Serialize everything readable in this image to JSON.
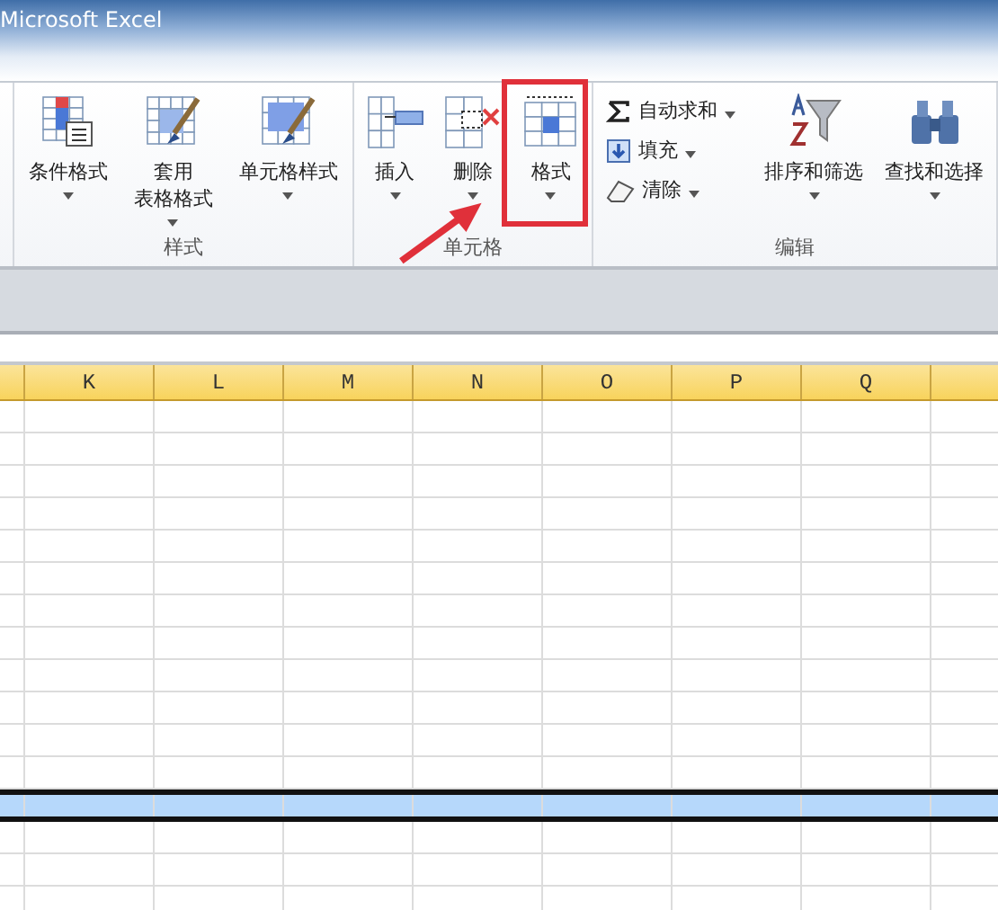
{
  "window": {
    "title": "Microsoft Excel"
  },
  "ribbon": {
    "groups": [
      {
        "label": "样式",
        "large": [
          {
            "lines": [
              "条件格式"
            ]
          },
          {
            "lines": [
              "套用",
              "表格格式"
            ]
          },
          {
            "lines": [
              "单元格样式"
            ]
          }
        ]
      },
      {
        "label": "单元格",
        "large": [
          {
            "lines": [
              "插入"
            ]
          },
          {
            "lines": [
              "删除"
            ]
          },
          {
            "lines": [
              "格式"
            ]
          }
        ]
      },
      {
        "label": "编辑",
        "small": [
          {
            "label": "自动求和"
          },
          {
            "label": "填充"
          },
          {
            "label": "清除"
          }
        ],
        "large": [
          {
            "lines": [
              "排序和筛选"
            ]
          },
          {
            "lines": [
              "查找和选择"
            ]
          }
        ]
      }
    ]
  },
  "sheet": {
    "columns": [
      "K",
      "L",
      "M",
      "N",
      "O",
      "P",
      "Q"
    ],
    "rows": [
      {
        "selected": false
      },
      {
        "selected": false
      },
      {
        "selected": false
      },
      {
        "selected": false
      },
      {
        "selected": false
      },
      {
        "selected": false
      },
      {
        "selected": false
      },
      {
        "selected": false
      },
      {
        "selected": false
      },
      {
        "selected": false
      },
      {
        "selected": false
      },
      {
        "selected": false
      },
      {
        "selected": true
      },
      {
        "selected": false
      },
      {
        "selected": false
      },
      {
        "selected": false
      }
    ]
  }
}
